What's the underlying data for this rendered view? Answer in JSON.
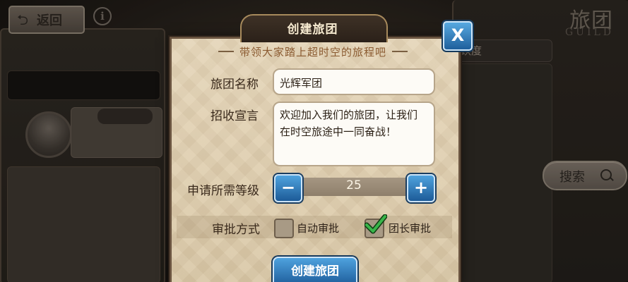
{
  "background": {
    "back_button": {
      "label": "返回",
      "icon": "back-arrow-icon"
    },
    "info_icon": "i",
    "guild_title": "旅团",
    "guild_subtitle": "GUILD",
    "right_header": "跃度",
    "search_button": {
      "label": "搜索",
      "icon": "search-icon"
    }
  },
  "dialog": {
    "title": "创建旅团",
    "subtitle": "带领大家踏上超时空的旅程吧",
    "close_label": "X",
    "fields": {
      "name": {
        "label": "旅团名称",
        "value": "光辉军团"
      },
      "slogan": {
        "label": "招收宣言",
        "line1": "欢迎加入我们的旅团，让我们",
        "line2": "在时空旅途中一同奋战！"
      },
      "level": {
        "label": "申请所需等级",
        "value": "25",
        "minus": "−",
        "plus": "+"
      },
      "approval": {
        "label": "审批方式",
        "options": [
          {
            "label": "自动审批",
            "checked": false
          },
          {
            "label": "团长审批",
            "checked": true
          }
        ]
      }
    },
    "create_button": "创建旅团"
  },
  "colors": {
    "accent_blue": "#1f5f9c",
    "panel_bg": "#e4d4b6",
    "title_bar": "#2b2119",
    "check_green": "#39b54a"
  }
}
